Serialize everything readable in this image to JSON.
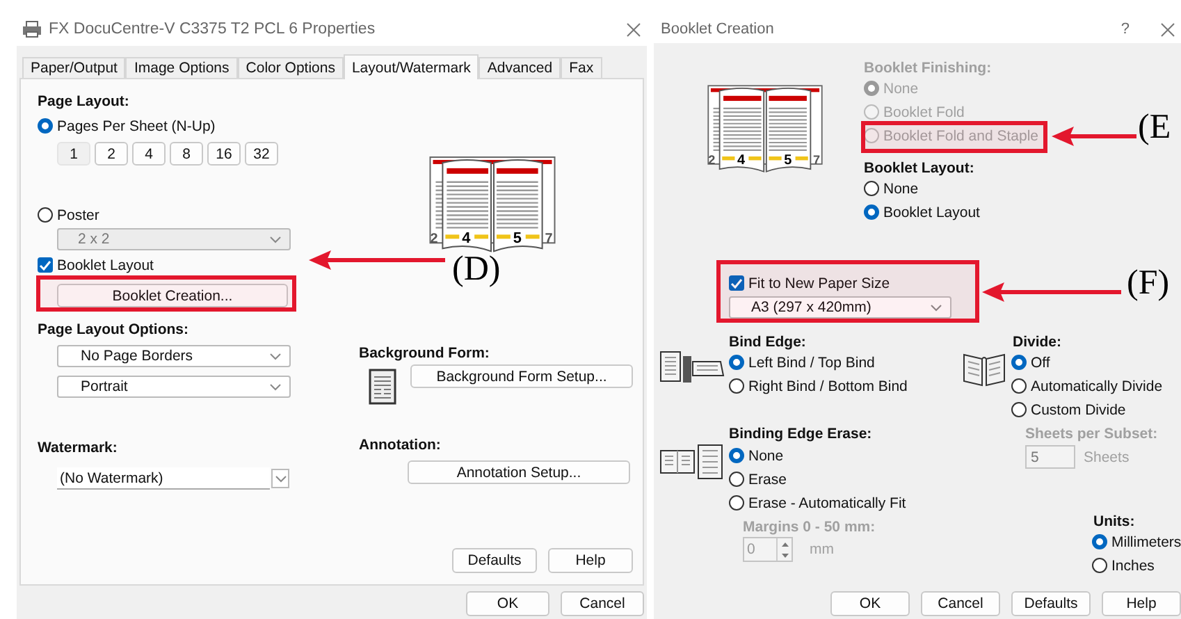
{
  "properties_dialog": {
    "title": "FX DocuCentre-V C3375 T2 PCL 6 Properties",
    "tabs": [
      {
        "label": "Paper/Output",
        "selected": false
      },
      {
        "label": "Image Options",
        "selected": false
      },
      {
        "label": "Color Options",
        "selected": false
      },
      {
        "label": "Layout/Watermark",
        "selected": true
      },
      {
        "label": "Advanced",
        "selected": false
      },
      {
        "label": "Fax",
        "selected": false
      }
    ],
    "page_layout": {
      "label": "Page Layout:",
      "pages_per_sheet": {
        "label": "Pages Per Sheet (N-Up)",
        "selected": true,
        "counts": [
          {
            "label": "1",
            "selected": true
          },
          {
            "label": "2",
            "selected": false
          },
          {
            "label": "4",
            "selected": false
          },
          {
            "label": "8",
            "selected": false
          },
          {
            "label": "16",
            "selected": false
          },
          {
            "label": "32",
            "selected": false
          }
        ]
      },
      "poster": {
        "label": "Poster",
        "selected": false,
        "size": "2 x 2",
        "disabled": true
      },
      "booklet_layout": {
        "label": "Booklet Layout",
        "checked": true
      },
      "booklet_creation_button": "Booklet Creation..."
    },
    "preview": {
      "page_numbers": [
        "2",
        "4",
        "5",
        "7"
      ]
    },
    "page_layout_options": {
      "label": "Page Layout Options:",
      "dropdowns": [
        "No Page Borders",
        "Portrait"
      ]
    },
    "watermark": {
      "label": "Watermark:",
      "value": "(No Watermark)"
    },
    "background_form": {
      "label": "Background Form:",
      "button": "Background Form Setup..."
    },
    "annotation": {
      "label": "Annotation:",
      "button": "Annotation Setup..."
    },
    "panel_buttons": [
      "Defaults",
      "Help"
    ],
    "buttons": [
      "OK",
      "Cancel"
    ]
  },
  "booklet_dialog": {
    "title": "Booklet Creation",
    "help": "?",
    "preview": {
      "page_numbers": [
        "2",
        "4",
        "5",
        "7"
      ]
    },
    "booklet_finishing": {
      "label": "Booklet Finishing:",
      "disabled": true,
      "options": [
        {
          "label": "None",
          "selected": true
        },
        {
          "label": "Booklet Fold",
          "selected": false
        },
        {
          "label": "Booklet Fold and Staple",
          "selected": false
        }
      ]
    },
    "booklet_layout": {
      "label": "Booklet Layout:",
      "options": [
        {
          "label": "None",
          "selected": false
        },
        {
          "label": "Booklet Layout",
          "selected": true
        }
      ]
    },
    "fit_to_new_paper_size": {
      "label": "Fit to New Paper Size",
      "checked": true,
      "value": "A3 (297 x 420mm)"
    },
    "bind_edge": {
      "label": "Bind Edge:",
      "options": [
        {
          "label": "Left Bind / Top Bind",
          "selected": true
        },
        {
          "label": "Right Bind / Bottom Bind",
          "selected": false
        }
      ]
    },
    "divide": {
      "label": "Divide:",
      "options": [
        {
          "label": "Off",
          "selected": true
        },
        {
          "label": "Automatically Divide",
          "selected": false
        },
        {
          "label": "Custom Divide",
          "selected": false
        }
      ],
      "sheets_per_subset": {
        "label": "Sheets per Subset:",
        "value": "5",
        "unit": "Sheets",
        "disabled": true
      }
    },
    "binding_edge_erase": {
      "label": "Binding Edge Erase:",
      "options": [
        {
          "label": "None",
          "selected": true
        },
        {
          "label": "Erase",
          "selected": false
        },
        {
          "label": "Erase - Automatically Fit",
          "selected": false
        }
      ],
      "margins": {
        "label": "Margins 0 - 50 mm:",
        "value": "0",
        "unit": "mm",
        "disabled": true
      }
    },
    "units": {
      "label": "Units:",
      "options": [
        {
          "label": "Millimeters",
          "selected": true
        },
        {
          "label": "Inches",
          "selected": false
        }
      ]
    },
    "buttons": [
      "OK",
      "Cancel",
      "Defaults",
      "Help"
    ]
  },
  "callouts": [
    {
      "label": "(D)"
    },
    {
      "label": "(E"
    },
    {
      "label": "(F)"
    }
  ]
}
